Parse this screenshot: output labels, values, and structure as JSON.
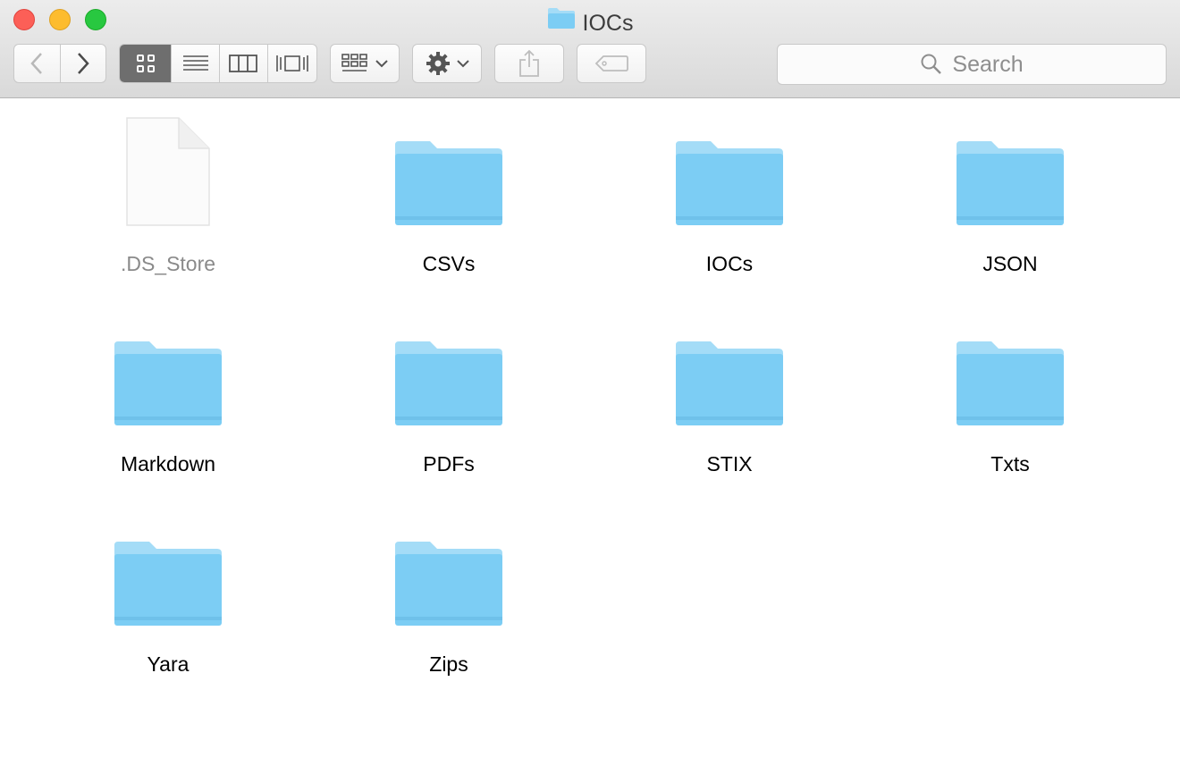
{
  "window": {
    "title": "IOCs"
  },
  "toolbar": {
    "back_icon": "chevron-left-icon",
    "forward_icon": "chevron-right-icon",
    "view_modes": [
      "icon-view-icon",
      "list-view-icon",
      "column-view-icon",
      "cover-flow-icon"
    ],
    "active_view": "icon-view-icon",
    "group_icon": "group-by-icon",
    "action_icon": "gear-icon",
    "share_icon": "share-icon",
    "tags_icon": "tag-icon",
    "search": {
      "placeholder": "Search"
    }
  },
  "files": [
    {
      "name": ".DS_Store",
      "kind": "file",
      "dimmed": true
    },
    {
      "name": "CSVs",
      "kind": "folder"
    },
    {
      "name": "IOCs",
      "kind": "folder"
    },
    {
      "name": "JSON",
      "kind": "folder"
    },
    {
      "name": "Markdown",
      "kind": "folder"
    },
    {
      "name": "PDFs",
      "kind": "folder"
    },
    {
      "name": "STIX",
      "kind": "folder"
    },
    {
      "name": "Txts",
      "kind": "folder"
    },
    {
      "name": "Yara",
      "kind": "folder"
    },
    {
      "name": "Zips",
      "kind": "folder"
    }
  ],
  "colors": {
    "folder_top": "#a4dcf7",
    "folder_body": "#7ccdf4",
    "close": "#fc5f57",
    "minimize": "#fdbc2e",
    "zoom": "#28c840"
  }
}
